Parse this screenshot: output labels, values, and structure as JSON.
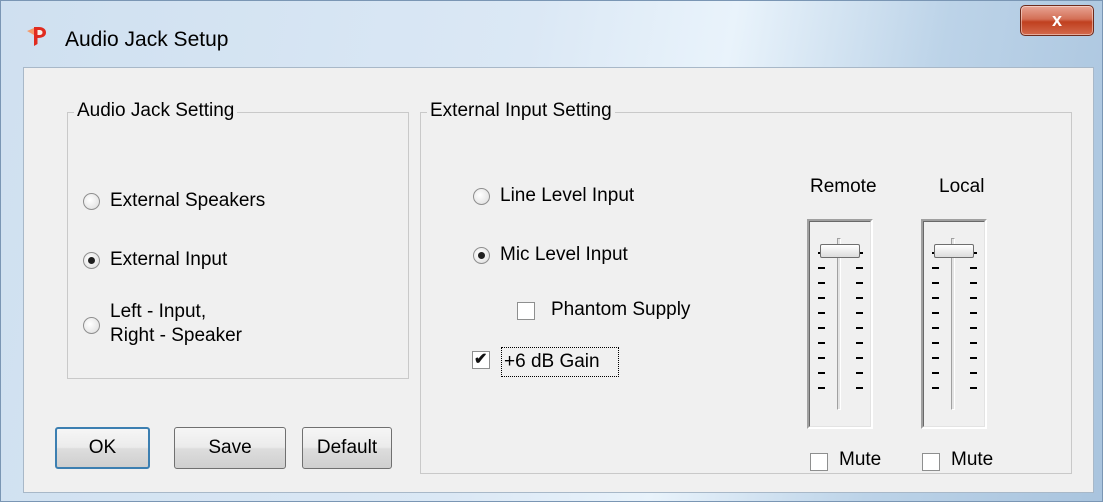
{
  "window": {
    "title": "Audio Jack Setup",
    "close_label": "x"
  },
  "audio_jack": {
    "legend": "Audio Jack Setting",
    "options": [
      {
        "label": "External Speakers",
        "selected": false
      },
      {
        "label": "External Input",
        "selected": true
      },
      {
        "label_line1": "Left - Input,",
        "label_line2": "Right - Speaker",
        "selected": false
      }
    ]
  },
  "external_input": {
    "legend": "External Input Setting",
    "line_level_label": "Line Level Input",
    "line_level_selected": false,
    "mic_level_label": "Mic Level Input",
    "mic_level_selected": true,
    "phantom_label": "Phantom Supply",
    "phantom_checked": false,
    "gain_label": "+6 dB Gain",
    "gain_checked": true,
    "remote": {
      "label": "Remote",
      "mute_label": "Mute",
      "mute_checked": false,
      "level": 0.0
    },
    "local": {
      "label": "Local",
      "mute_label": "Mute",
      "mute_checked": false,
      "level": 0.0
    }
  },
  "buttons": {
    "ok": "OK",
    "save": "Save",
    "default": "Default"
  },
  "colors": {
    "title_accent": "#e02b1f",
    "close_red": "#c0401f",
    "dialog_bg": "#f0f0f0"
  }
}
